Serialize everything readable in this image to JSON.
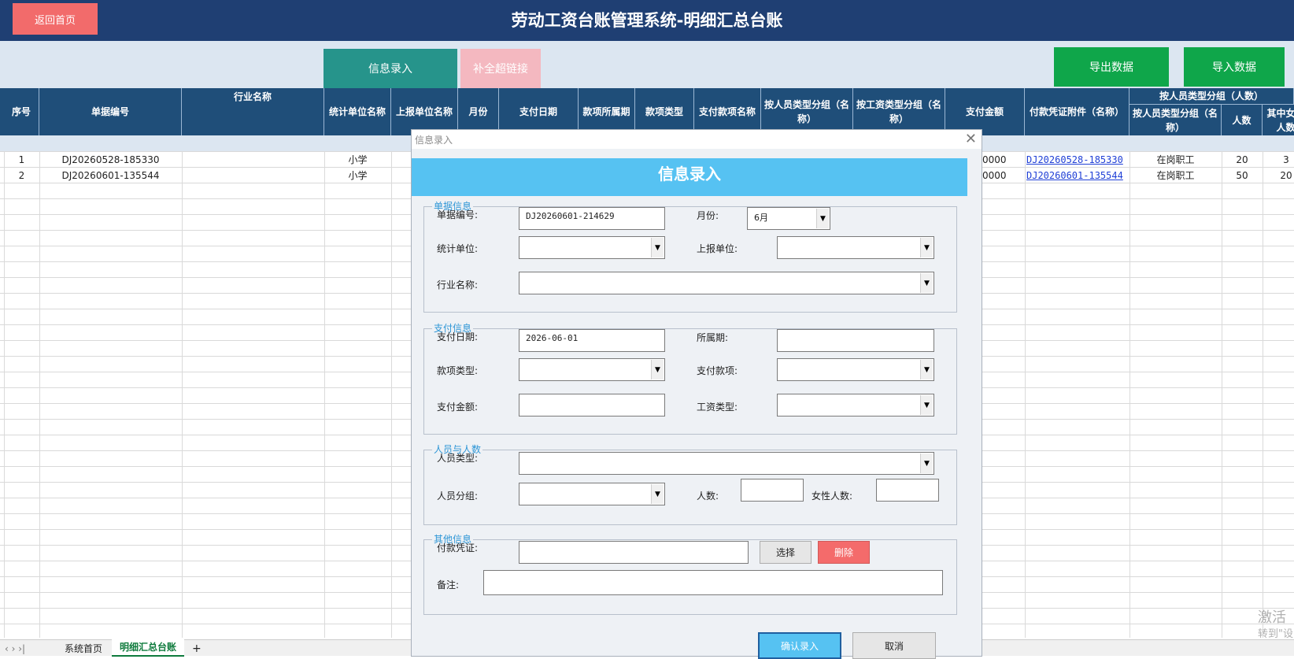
{
  "header": {
    "home_button": "返回首页",
    "title": "劳动工资台账管理系统-明细汇总台账"
  },
  "toolbar": {
    "info_entry": "信息录入",
    "refill_link": "补全超链接",
    "export": "导出数据",
    "import": "导入数据"
  },
  "columns": {
    "seq": "序号",
    "doc_no": "单据编号",
    "industry": "行业名称",
    "stat_unit": "统计单位名称",
    "report_unit": "上报单位名称",
    "month": "月份",
    "pay_date": "支付日期",
    "period": "款项所属期",
    "pay_type": "款项类型",
    "pay_item": "支付款项名称",
    "by_person_group": "按人员类型分组（名称）",
    "by_wage_group": "按工资类型分组（名称）",
    "amount": "支付金额",
    "voucher": "付款凭证附件（名称）",
    "group_header": "按人员类型分组（人数）",
    "sub_group_name": "按人员类型分组（名称）",
    "sub_count": "人数",
    "sub_female": "其中女性人数"
  },
  "rows": [
    {
      "seq": "1",
      "doc_no": "DJ20260528-185330",
      "stat_unit": "小学",
      "amount": "0000",
      "voucher": "DJ20260528-185330",
      "group": "在岗职工",
      "count": "20",
      "female": "3"
    },
    {
      "seq": "2",
      "doc_no": "DJ20260601-135544",
      "stat_unit": "小学",
      "amount": "0000",
      "voucher": "DJ20260601-135544",
      "group": "在岗职工",
      "count": "50",
      "female": "20"
    }
  ],
  "sheet_tabs": {
    "home": "系统首页",
    "detail": "明细汇总台账",
    "add": "+"
  },
  "watermark": {
    "line1": "激活",
    "line2": "转到\"设"
  },
  "dialog": {
    "caption": "信息录入",
    "banner": "信息录入",
    "sections": {
      "doc": "单据信息",
      "pay": "支付信息",
      "people": "人员与人数",
      "other": "其他信息"
    },
    "labels": {
      "doc_no": "单据编号:",
      "month": "月份:",
      "stat_unit": "统计单位:",
      "report_unit": "上报单位:",
      "industry": "行业名称:",
      "pay_date": "支付日期:",
      "period": "所属期:",
      "pay_type": "款项类型:",
      "pay_item": "支付款项:",
      "amount": "支付金额:",
      "wage_type": "工资类型:",
      "person_type": "人员类型:",
      "person_group": "人员分组:",
      "count": "人数:",
      "female": "女性人数:",
      "voucher": "付款凭证:",
      "remark": "备注:"
    },
    "values": {
      "doc_no": "DJ20260601-214629",
      "month": "6月",
      "pay_date": "2026-06-01"
    },
    "buttons": {
      "select": "选择",
      "delete": "删除",
      "confirm": "确认录入",
      "cancel": "取消"
    }
  }
}
